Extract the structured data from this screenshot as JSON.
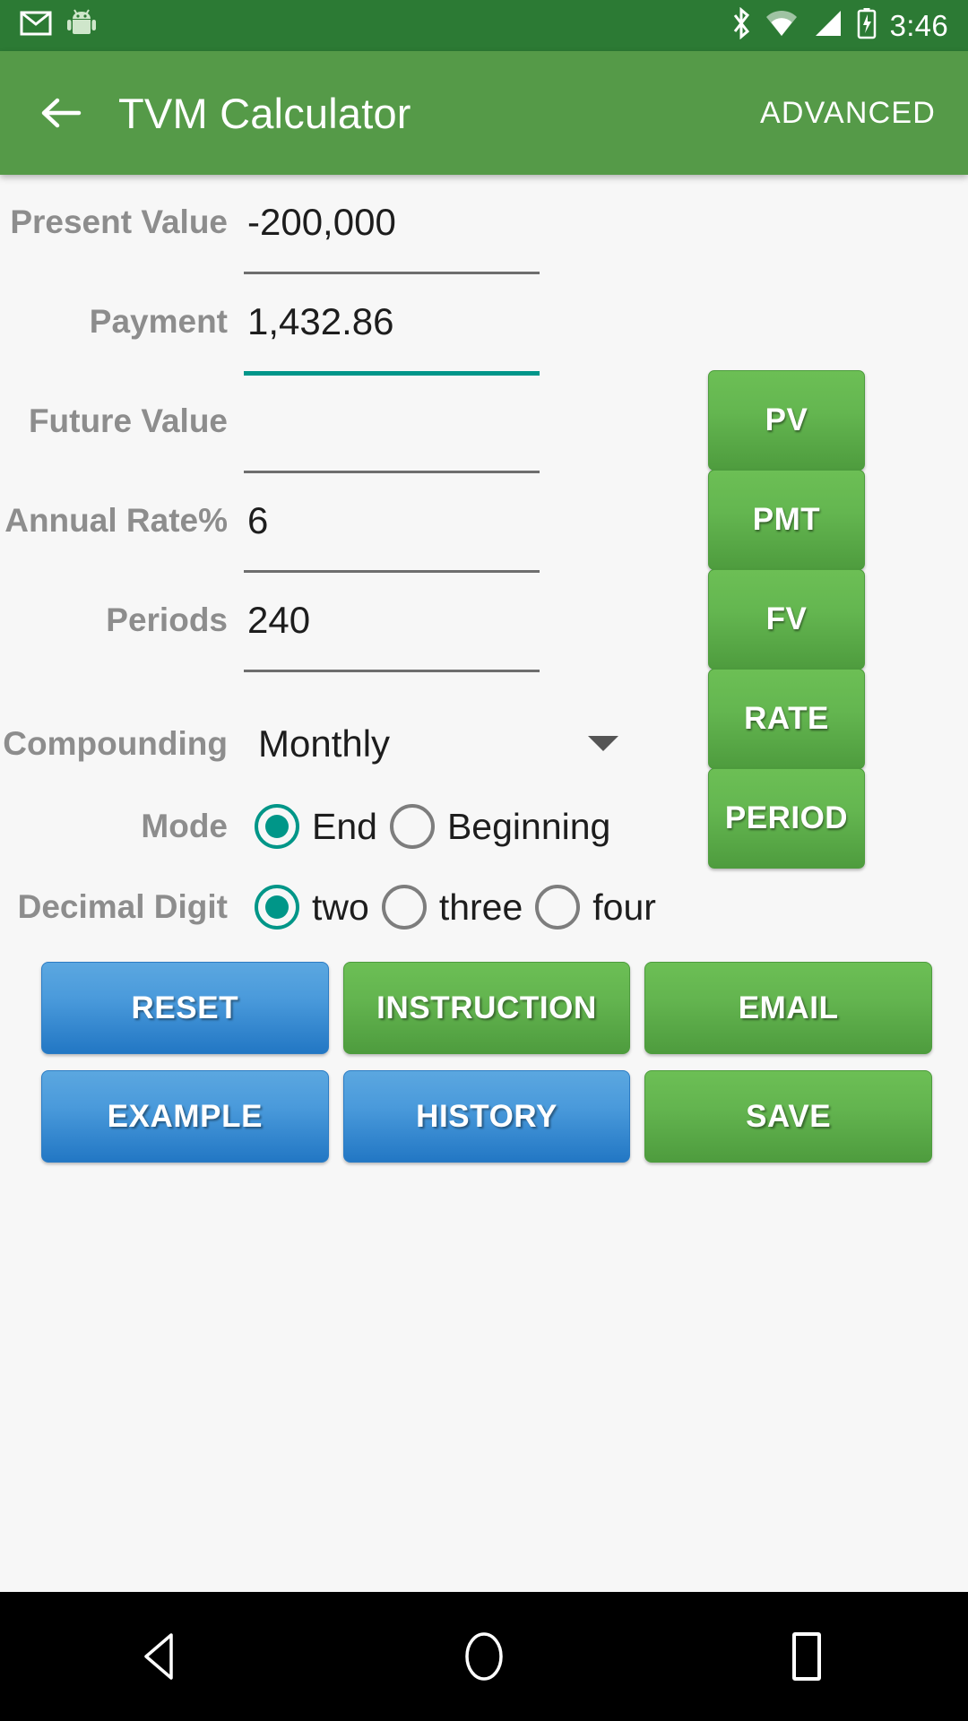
{
  "status_bar": {
    "time": "3:46",
    "icons": [
      "gmail-icon",
      "android-icon",
      "bluetooth-icon",
      "wifi-icon",
      "signal-icon",
      "battery-charging-icon"
    ],
    "bg_color": "#2c7a34"
  },
  "app_bar": {
    "title": "TVM Calculator",
    "back_label": "back-arrow",
    "action_label": "ADVANCED",
    "bg_color": "#559a48"
  },
  "form": {
    "fields": [
      {
        "label": "Present Value",
        "value": "-200,000",
        "focused": false,
        "button": "PV"
      },
      {
        "label": "Payment",
        "value": "1,432.86",
        "focused": true,
        "button": "PMT"
      },
      {
        "label": "Future Value",
        "value": "",
        "focused": false,
        "button": "FV"
      },
      {
        "label": "Annual Rate%",
        "value": "6",
        "focused": false,
        "button": "RATE"
      },
      {
        "label": "Periods",
        "value": "240",
        "focused": false,
        "button": "PERIOD"
      }
    ],
    "compounding": {
      "label": "Compounding",
      "value": "Monthly"
    },
    "mode": {
      "label": "Mode",
      "options": [
        {
          "text": "End",
          "selected": true
        },
        {
          "text": "Beginning",
          "selected": false
        }
      ]
    },
    "decimal_digit": {
      "label": "Decimal Digit",
      "options": [
        {
          "text": "two",
          "selected": true
        },
        {
          "text": "three",
          "selected": false
        },
        {
          "text": "four",
          "selected": false
        }
      ]
    }
  },
  "actions": {
    "row1": [
      {
        "label": "RESET",
        "color": "blue"
      },
      {
        "label": "INSTRUCTION",
        "color": "green"
      },
      {
        "label": "EMAIL",
        "color": "green"
      }
    ],
    "row2": [
      {
        "label": "EXAMPLE",
        "color": "blue"
      },
      {
        "label": "HISTORY",
        "color": "blue"
      },
      {
        "label": "SAVE",
        "color": "green"
      }
    ]
  },
  "nav_bar": {
    "items": [
      "back-triangle-icon",
      "home-circle-icon",
      "recents-square-icon"
    ]
  },
  "colors": {
    "accent_teal": "#009688",
    "green_primary": "#559a48",
    "blue_primary": "#2277c4",
    "label_gray": "#8d8d8d"
  }
}
